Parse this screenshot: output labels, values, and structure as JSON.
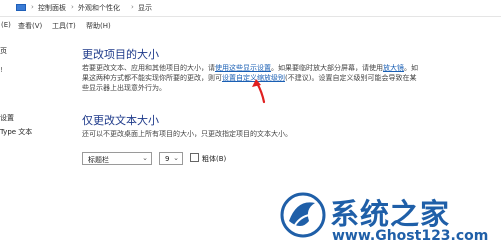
{
  "address_bar": {
    "separator": "›",
    "crumbs": [
      "控制面板",
      "外观和个性化",
      "显示"
    ]
  },
  "menu": {
    "items": [
      "查看(V)",
      "工具(T)",
      "帮助(H)"
    ],
    "edge_label": "(E)"
  },
  "left_nav": {
    "items": [
      "页",
      "设置",
      "Type 文本"
    ],
    "fragment": "!"
  },
  "section_size": {
    "title": "更改项目的大小",
    "line1_before": "若要更改文本、应用和其他项目的大小，请",
    "line1_link1": "使用这些显示设置",
    "line1_mid": "。如果要临时放大部分屏幕，请使用",
    "line1_link2": "放大镜",
    "line1_end": "。如",
    "line2": "果这两种方式都不能实现你所要的更改，则可",
    "line2_link": "设置自定义缩放级别",
    "line2_after": "(不建议)。设置自定义级别可能会导致在某",
    "line3": "些显示器上出现意外行为。"
  },
  "section_text": {
    "title": "仅更改文本大小",
    "description": "还可以不更改桌面上所有项目的大小，只更改指定项目的文本大小。"
  },
  "controls": {
    "item_select": "标题栏",
    "size_select": "9",
    "bold_label": "粗体(B)",
    "bold_checked": false
  },
  "watermark": {
    "text": "系统之家",
    "url": "www.Ghost123.com"
  },
  "colors": {
    "heading": "#1e3a8a",
    "link": "#1a5fb4",
    "arrow": "#e02020",
    "watermark": "#1f5fa8"
  }
}
